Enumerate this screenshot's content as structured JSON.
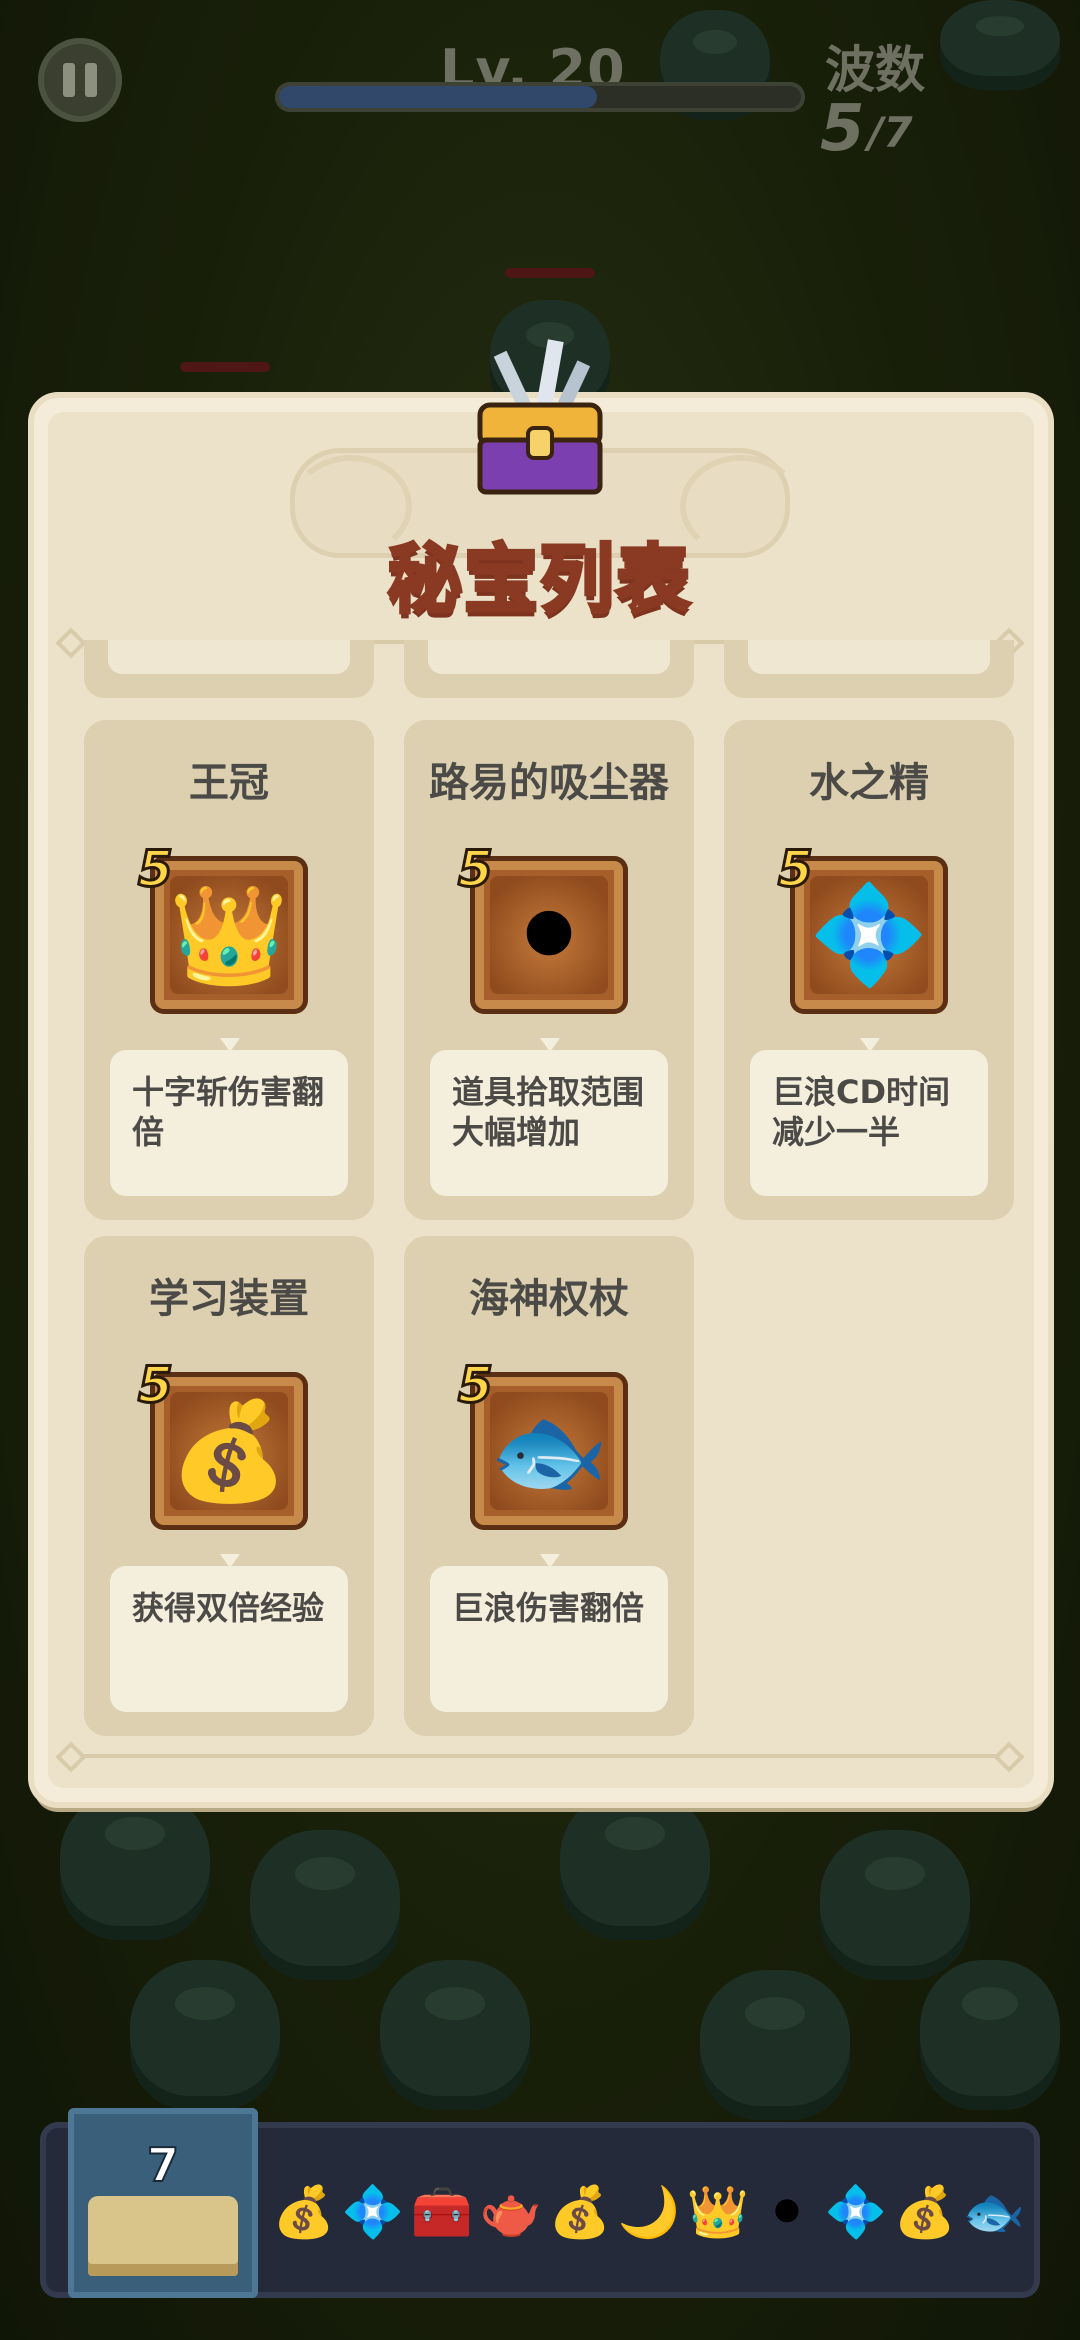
{
  "hud": {
    "level_label": "Lv. 20",
    "xp_progress": 0.6,
    "wave_label": "波数",
    "wave_current": "5",
    "wave_total": "/7"
  },
  "panel": {
    "title": "秘宝列表",
    "items": [
      {
        "name": "王冠",
        "level": "5",
        "icon": "crown-icon",
        "glyph": "👑",
        "desc": "十字斩伤害翻倍"
      },
      {
        "name": "路易的吸尘器",
        "level": "5",
        "icon": "vacuum-pipe-icon",
        "glyph": "⚫",
        "desc": "道具拾取范围大幅增加"
      },
      {
        "name": "水之精",
        "level": "5",
        "icon": "water-rune-stone-icon",
        "glyph": "💠",
        "desc": "巨浪CD时间减少一半"
      },
      {
        "name": "学习装置",
        "level": "5",
        "icon": "sack-icon",
        "glyph": "💰",
        "desc": "获得双倍经验"
      },
      {
        "name": "海神权杖",
        "level": "5",
        "icon": "fish-icon",
        "glyph": "🐟",
        "desc": "巨浪伤害翻倍"
      }
    ]
  },
  "bottom_bar": {
    "book_count": "7",
    "slots": [
      {
        "icon": "sack-icon",
        "glyph": "💰"
      },
      {
        "icon": "rune-stone-icon",
        "glyph": "💠"
      },
      {
        "icon": "chest-icon",
        "glyph": "🧰"
      },
      {
        "icon": "teapot-icon",
        "glyph": "🫖"
      },
      {
        "icon": "sack-icon",
        "glyph": "💰"
      },
      {
        "icon": "horn-icon",
        "glyph": "🌙"
      },
      {
        "icon": "crown-icon",
        "glyph": "👑"
      },
      {
        "icon": "vacuum-pipe-icon",
        "glyph": "⚫"
      },
      {
        "icon": "rune-stone-icon",
        "glyph": "💠"
      },
      {
        "icon": "sack-icon",
        "glyph": "💰"
      },
      {
        "icon": "fish-icon",
        "glyph": "🐟"
      }
    ]
  }
}
